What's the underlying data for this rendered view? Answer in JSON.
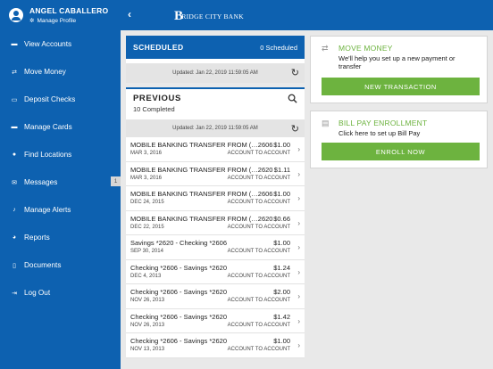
{
  "user": {
    "name": "ANGEL CABALLERO",
    "manage_profile": "Manage Profile"
  },
  "nav": [
    {
      "label": "View Accounts",
      "icon": "credit-card-icon",
      "glyph": "▬"
    },
    {
      "label": "Move Money",
      "icon": "dollar-transfer-icon",
      "glyph": "⇄"
    },
    {
      "label": "Deposit Checks",
      "icon": "check-deposit-icon",
      "glyph": "▭"
    },
    {
      "label": "Manage Cards",
      "icon": "card-icon",
      "glyph": "▬"
    },
    {
      "label": "Find Locations",
      "icon": "map-pin-icon",
      "glyph": "●"
    },
    {
      "label": "Messages",
      "icon": "envelope-icon",
      "glyph": "✉",
      "badge": "1"
    },
    {
      "label": "Manage Alerts",
      "icon": "bell-icon",
      "glyph": "♪"
    },
    {
      "label": "Reports",
      "icon": "pie-chart-icon",
      "glyph": "◕"
    },
    {
      "label": "Documents",
      "icon": "document-icon",
      "glyph": "▯"
    },
    {
      "label": "Log Out",
      "icon": "logout-icon",
      "glyph": "⇥"
    }
  ],
  "header": {
    "logo_text": "RIDGE CITY BANK",
    "logo_letter": "B",
    "back_glyph": "‹"
  },
  "scheduled": {
    "title": "SCHEDULED",
    "count": "0 Scheduled",
    "updated": "Updated: Jan 22, 2019 11:59:05 AM"
  },
  "previous": {
    "title": "PREVIOUS",
    "count": "10 Completed",
    "updated": "Updated: Jan 22, 2019 11:59:05 AM",
    "rows": [
      {
        "desc": "MOBILE BANKING TRANSFER FROM (…2606",
        "amount": "$1.00",
        "date": "MAR 3, 2016",
        "type": "ACCOUNT TO ACCOUNT"
      },
      {
        "desc": "MOBILE BANKING TRANSFER FROM (…2620",
        "amount": "$1.11",
        "date": "MAR 3, 2016",
        "type": "ACCOUNT TO ACCOUNT"
      },
      {
        "desc": "MOBILE BANKING TRANSFER FROM (…2606",
        "amount": "$1.00",
        "date": "DEC 24, 2015",
        "type": "ACCOUNT TO ACCOUNT"
      },
      {
        "desc": "MOBILE BANKING TRANSFER FROM (…2620",
        "amount": "$0.66",
        "date": "DEC 22, 2015",
        "type": "ACCOUNT TO ACCOUNT"
      },
      {
        "desc": "Savings *2620 - Checking *2606",
        "amount": "$1.00",
        "date": "SEP 30, 2014",
        "type": "ACCOUNT TO ACCOUNT"
      },
      {
        "desc": "Checking *2606 - Savings *2620",
        "amount": "$1.24",
        "date": "DEC 4, 2013",
        "type": "ACCOUNT TO ACCOUNT"
      },
      {
        "desc": "Checking *2606 - Savings *2620",
        "amount": "$2.00",
        "date": "NOV 26, 2013",
        "type": "ACCOUNT TO ACCOUNT"
      },
      {
        "desc": "Checking *2606 - Savings *2620",
        "amount": "$1.42",
        "date": "NOV 26, 2013",
        "type": "ACCOUNT TO ACCOUNT"
      },
      {
        "desc": "Checking *2606 - Savings *2620",
        "amount": "$1.00",
        "date": "NOV 13, 2013",
        "type": "ACCOUNT TO ACCOUNT"
      }
    ]
  },
  "move_money": {
    "title": "MOVE MONEY",
    "desc": "We'll help you set up a new payment or transfer",
    "button": "NEW TRANSACTION"
  },
  "bill_pay": {
    "title": "BILL PAY ENROLLMENT",
    "desc": "Click here to set up Bill Pay",
    "button": "ENROLL NOW"
  },
  "colors": {
    "primary": "#0d61b0",
    "accent_green": "#6db33f"
  }
}
